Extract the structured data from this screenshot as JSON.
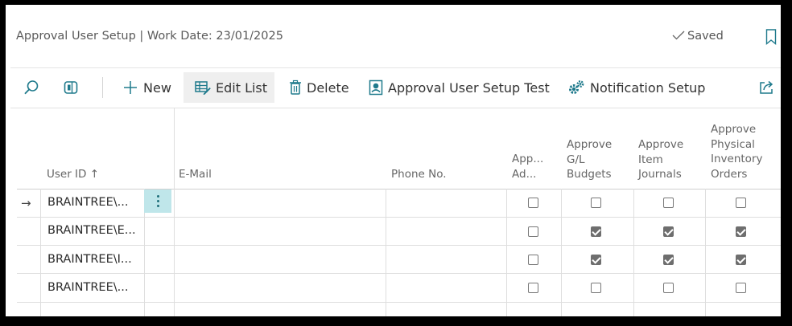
{
  "header": {
    "title": "Approval User Setup | Work Date: 23/01/2025",
    "saved_label": "Saved"
  },
  "toolbar": {
    "new_label": "New",
    "edit_list_label": "Edit List",
    "delete_label": "Delete",
    "setup_test_label": "Approval User Setup Test",
    "notification_label": "Notification Setup"
  },
  "table": {
    "columns": {
      "user_id": "User ID ↑",
      "email": "E-Mail",
      "phone": "Phone No.",
      "app_admin": [
        "App...",
        "Ad..."
      ],
      "approve_gl": [
        "Approve",
        "G/L",
        "Budgets"
      ],
      "approve_item": [
        "Approve",
        "Item",
        "Journals"
      ],
      "approve_inv": [
        "Approve",
        "Physical",
        "Inventory",
        "Orders"
      ]
    },
    "row_indicator": "→",
    "rows": [
      {
        "user_id": "BRAINTREE\\...",
        "email": "",
        "phone": "",
        "app_admin": false,
        "approve_gl": false,
        "approve_item": false,
        "approve_inv": false
      },
      {
        "user_id": "BRAINTREE\\E...",
        "email": "",
        "phone": "",
        "app_admin": false,
        "approve_gl": true,
        "approve_item": true,
        "approve_inv": true
      },
      {
        "user_id": "BRAINTREE\\I...",
        "email": "",
        "phone": "",
        "app_admin": false,
        "approve_gl": true,
        "approve_item": true,
        "approve_inv": true
      },
      {
        "user_id": "BRAINTREE\\...",
        "email": "",
        "phone": "",
        "app_admin": false,
        "approve_gl": false,
        "approve_item": false,
        "approve_inv": false
      }
    ]
  },
  "colors": {
    "accent": "#1f7a8c",
    "selected_cell": "#bfe6ea",
    "active_tab_bg": "#efefef"
  }
}
